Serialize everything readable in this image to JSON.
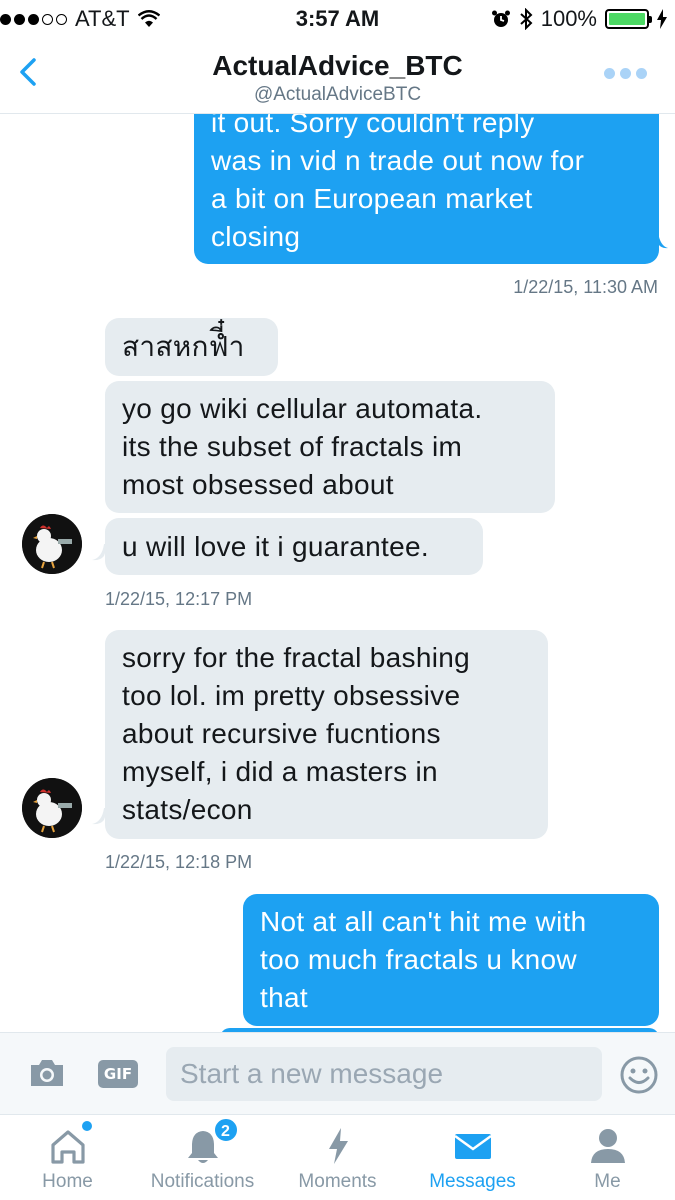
{
  "status_bar": {
    "carrier": "AT&T",
    "time": "3:57 AM",
    "battery": "100%"
  },
  "header": {
    "title": "ActualAdvice_BTC",
    "handle": "@ActualAdviceBTC"
  },
  "messages": [
    {
      "direction": "out",
      "lines": [
        "it out. Sorry couldn't reply",
        "was in vid n trade out now for",
        "a bit on European market",
        "closing"
      ]
    },
    {
      "direction": "out",
      "timestamp": "1/22/15, 11:30 AM"
    },
    {
      "direction": "in",
      "lines": [
        "สาสหกฟี๋ำ"
      ]
    },
    {
      "direction": "in",
      "lines": [
        "yo go wiki cellular automata.",
        "its the subset of fractals im",
        "most obsessed about"
      ]
    },
    {
      "direction": "in",
      "lines": [
        "u will love it i guarantee."
      ]
    },
    {
      "direction": "in",
      "timestamp": "1/22/15, 12:17 PM"
    },
    {
      "direction": "in",
      "lines": [
        "sorry for the fractal bashing",
        "too lol. im pretty obsessive",
        "about recursive fucntions",
        "myself, i did a masters in",
        "stats/econ"
      ]
    },
    {
      "direction": "in",
      "timestamp": "1/22/15, 12:18 PM"
    },
    {
      "direction": "out",
      "lines": [
        "Not at all can't hit me with",
        "too much fractals u know",
        "that"
      ]
    }
  ],
  "composer": {
    "gif_label": "GIF",
    "placeholder": "Start a new message"
  },
  "tabs": [
    {
      "label": "Home",
      "icon": "home-icon"
    },
    {
      "label": "Notifications",
      "icon": "bell-icon",
      "badge": "2"
    },
    {
      "label": "Moments",
      "icon": "lightning-icon"
    },
    {
      "label": "Messages",
      "icon": "envelope-icon",
      "active": true
    },
    {
      "label": "Me",
      "icon": "person-icon"
    }
  ],
  "colors": {
    "accent": "#1da1f2",
    "incoming_bubble": "#e6ecf0",
    "muted": "#657786"
  }
}
